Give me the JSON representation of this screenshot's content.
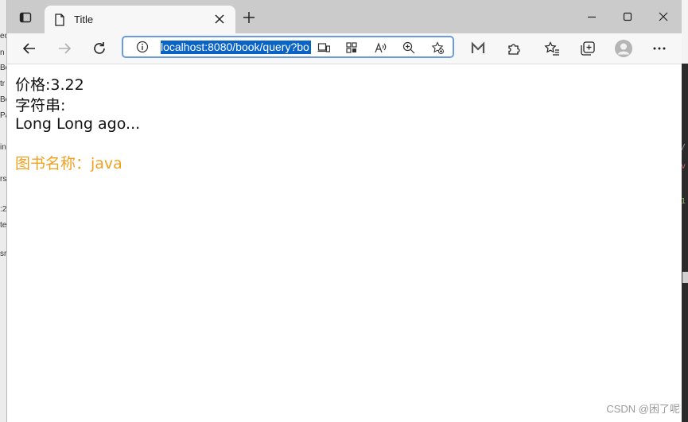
{
  "tab": {
    "title": "Title"
  },
  "address_bar": {
    "url": "localhost:8080/book/query?bo"
  },
  "content": {
    "price_line": "价格:3.22",
    "string_label": "字符串:",
    "string_value": "Long Long ago...",
    "book_name_line": "图书名称：java"
  },
  "watermark": "CSDN @困了呢",
  "icons": [
    "tab-actions-icon",
    "page-icon",
    "close-icon",
    "plus-icon",
    "minimize-icon",
    "maximize-icon",
    "window-close-icon",
    "back-icon",
    "forward-icon",
    "refresh-icon",
    "info-icon",
    "immersive-reader-icon",
    "apps-icon",
    "read-aloud-icon",
    "zoom-icon",
    "favorite-add-icon",
    "m-extension-icon",
    "extensions-icon",
    "favorites-icon",
    "collections-icon",
    "profile-icon",
    "more-icon"
  ],
  "colors": {
    "highlight": "#0a64c6",
    "book_name": "#f0a020",
    "address_focus": "#6a9be0"
  }
}
